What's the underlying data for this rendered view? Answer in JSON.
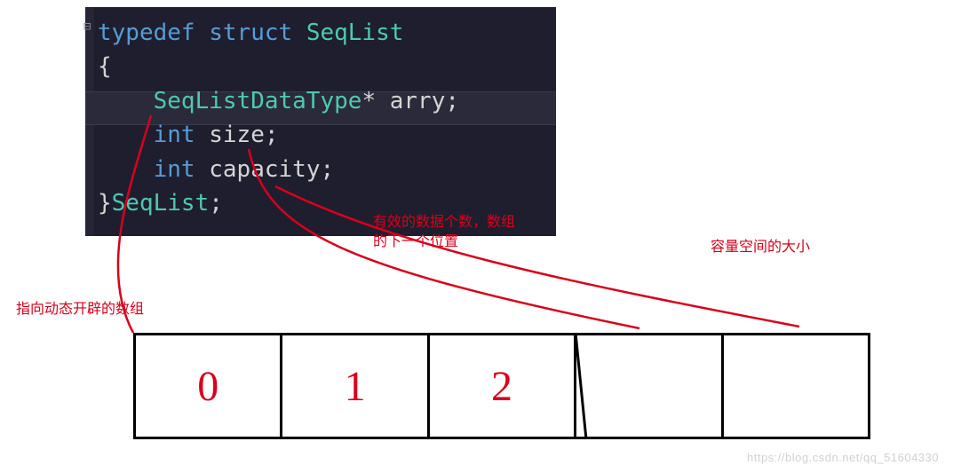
{
  "code": {
    "line1_kw1": "typedef",
    "line1_kw2": "struct",
    "line1_type": "SeqList",
    "line2_brace": "{",
    "line3_type": "SeqListDataType",
    "line3_ptr": "*",
    "line3_id": "arry",
    "line3_semi": ";",
    "line4_kw": "int",
    "line4_id": "size",
    "line4_semi": ";",
    "line5_kw": "int",
    "line5_id": "capacity",
    "line5_semi": ";",
    "line6_brace": "}",
    "line6_type": "SeqList",
    "line6_semi": ";"
  },
  "annotations": {
    "arry_note": "指向动态开辟的数组",
    "size_note_l1": "有效的数据个数，数组",
    "size_note_l2": "的下一个位置",
    "capacity_note": "容量空间的大小"
  },
  "array_cells": [
    "0",
    "1",
    "2",
    "",
    ""
  ],
  "watermark": "https://blog.csdn.net/qq_51604330",
  "colors": {
    "annotation": "#d9001b",
    "keyword": "#569cd6",
    "type": "#4ec9b0",
    "code_bg": "#1e1e2e"
  }
}
